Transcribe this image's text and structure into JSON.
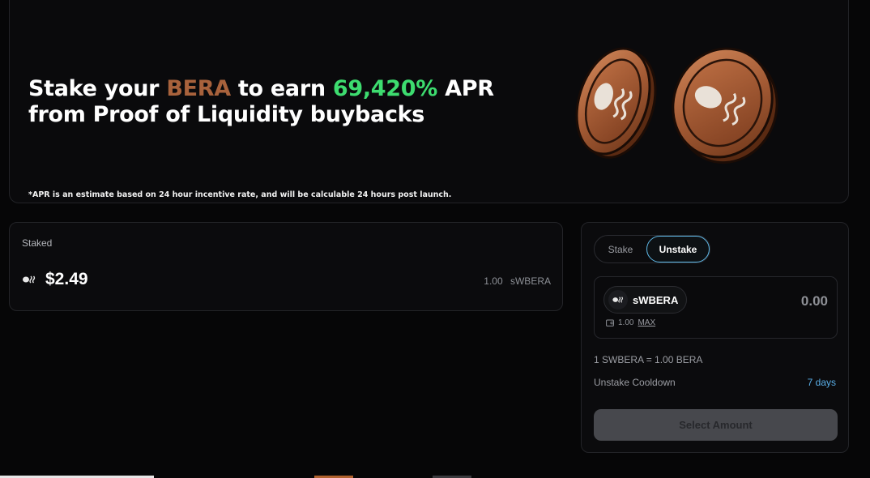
{
  "hero": {
    "title_part1": "Stake your ",
    "title_highlight_token": "BERA",
    "title_part2": " to earn ",
    "title_highlight_apr": "69,420%",
    "title_part3": " APR",
    "title_line2": "from Proof of Liquidity buybacks",
    "note": "*APR is an estimate based on 24 hour incentive rate, and will be calculable 24 hours post launch.",
    "image": "bronze-coins-illustration"
  },
  "staked": {
    "label": "Staked",
    "value": "$2.49",
    "amount": "1.00",
    "token": "sWBERA",
    "icon": "bear-chain-token-icon"
  },
  "action": {
    "tabs": [
      {
        "label": "Stake",
        "active": false
      },
      {
        "label": "Unstake",
        "active": true
      }
    ],
    "input": {
      "token_name": "sWBERA",
      "placeholder": "0.00",
      "balance": "1.00",
      "max_label": "MAX",
      "icon": "wallet-icon"
    },
    "rate": "1 SWBERA = 1.00 BERA",
    "cooldown_label": "Unstake Cooldown",
    "cooldown_value": "7 days",
    "submit_label": "Select Amount"
  },
  "colors": {
    "bera": "#a8623c",
    "apr": "#3ddc6f",
    "tab_active_border": "#5fb9e8",
    "cooldown": "#5aafe8"
  }
}
